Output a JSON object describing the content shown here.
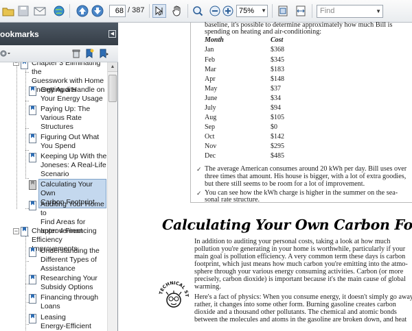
{
  "toolbar": {
    "page_current": "68",
    "page_total": "/ 387",
    "zoom": "75%",
    "find_placeholder": "Find",
    "colors": {
      "toolbar_bg": "#eef0f2",
      "accent": "#2a6fbf"
    }
  },
  "bookmarks": {
    "title": "ookmarks",
    "items": [
      {
        "label": [
          "Chapter 3 Eliminating the",
          "Guesswork with Home",
          "Energy Audits"
        ]
      },
      {
        "label": [
          "Getting a Handle on",
          "Your Energy Usage"
        ]
      },
      {
        "label": [
          "Paying Up: The",
          "Various Rate",
          "Structures"
        ]
      },
      {
        "label": [
          "Figuring Out What",
          "You Spend"
        ]
      },
      {
        "label": [
          "Keeping Up With the",
          "Joneses: A Real-Life",
          "Scenario"
        ]
      },
      {
        "label": [
          "Calculating Your Own",
          "Carbon Footprint"
        ],
        "selected": true
      },
      {
        "label": [
          "Auditing Your Home to",
          "Find Areas for",
          "Improvement"
        ]
      },
      {
        "label": [
          "Chapter 4 Financing",
          "Efficiency Improvements"
        ]
      },
      {
        "label": [
          "Understanding the",
          "Different Types of",
          "Assistance"
        ]
      },
      {
        "label": [
          "Researching Your",
          "Subsidy Options"
        ]
      },
      {
        "label": [
          "Financing through",
          "Loans"
        ]
      },
      {
        "label": [
          "Leasing",
          "Energy-Efficient"
        ]
      }
    ]
  },
  "document": {
    "intro_lines": [
      "baseline, it's possible to determine approximately how much Bill is",
      "spending on heating and air-conditioning:"
    ],
    "table": {
      "headers": [
        "Month",
        "Cost"
      ],
      "rows": [
        [
          "Jan",
          "$368"
        ],
        [
          "Feb",
          "$345"
        ],
        [
          "Mar",
          "$183"
        ],
        [
          "Apr",
          "$148"
        ],
        [
          "May",
          "$37"
        ],
        [
          "June",
          "$34"
        ],
        [
          "July",
          "$94"
        ],
        [
          "Aug",
          "$105"
        ],
        [
          "Sep",
          "$0"
        ],
        [
          "Oct",
          "$142"
        ],
        [
          "Nov",
          "$295"
        ],
        [
          "Dec",
          "$485"
        ]
      ]
    },
    "bullets": [
      [
        "The average American consumes around 20 kWh per day. Bill uses over",
        "three times that amount. His house is bigger, with a lot of extra goodies,",
        "but there still seems to be room for a lot of improvement."
      ],
      [
        "You can see how the kWh charge is higher in the summer on the sea-",
        "sonal rate structure."
      ]
    ],
    "heading": "Calculating Your Own Carbon Footprint",
    "para1": [
      "In addition to auditing your personal costs, taking a look at how much",
      "pollution you're generating in your home is worthwhile, particularly if your",
      "main goal is pollution efficiency. A very common term these days is carbon",
      "footprint, which just means how much carbon you're emitting into the atmo-",
      "sphere through your various energy consuming activities. Carbon (or more",
      "precisely, carbon dioxide) is important because it's the main cause of global",
      "warming."
    ],
    "para2": [
      "Here's a fact of physics: When you consume energy, it doesn't simply go away;",
      "rather, it changes into some other form. Burning gasoline creates carbon",
      "dioxide and a thousand other pollutants. The chemical and atomic bonds",
      "between the molecules and atoms in the gasoline are broken down, and heat"
    ],
    "tech_icon_text": "TECHNICAL STUFF"
  }
}
